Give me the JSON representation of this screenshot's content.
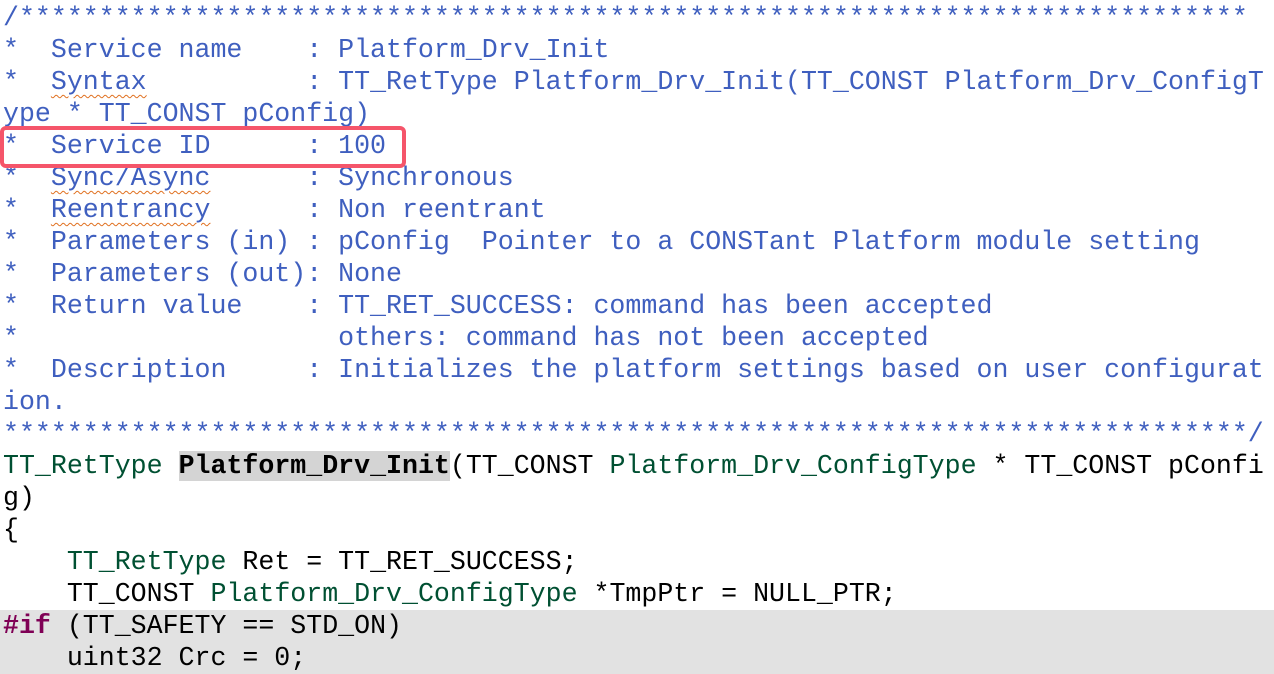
{
  "colors": {
    "comment": "#3f5fbf",
    "type": "#005032",
    "keyword": "#7f0055",
    "highlight": "#e2e2e2",
    "annotation": "#f5556a"
  },
  "lines": [
    {
      "hl": false,
      "segs": [
        {
          "s": "c",
          "x": "/*****************************************************************************"
        }
      ]
    },
    {
      "hl": false,
      "segs": [
        {
          "s": "c",
          "x": "*  Service name    : Platform_Drv_Init"
        }
      ]
    },
    {
      "hl": false,
      "segs": [
        {
          "s": "c",
          "x": "*  "
        },
        {
          "s": "c sq",
          "x": "Syntax"
        },
        {
          "s": "c",
          "x": "          : TT_RetType Platform_Drv_Init(TT_CONST Platform_Drv_ConfigType * TT_CONST pConfig)"
        }
      ]
    },
    {
      "hl": false,
      "segs": [
        {
          "s": "c",
          "x": "*  Service ID      : 100"
        }
      ]
    },
    {
      "hl": false,
      "segs": [
        {
          "s": "c",
          "x": "*  "
        },
        {
          "s": "c sq",
          "x": "Sync/Async"
        },
        {
          "s": "c",
          "x": "      : Synchronous"
        }
      ]
    },
    {
      "hl": false,
      "segs": [
        {
          "s": "c",
          "x": "*  "
        },
        {
          "s": "c sq",
          "x": "Reentrancy"
        },
        {
          "s": "c",
          "x": "      : Non reentrant"
        }
      ]
    },
    {
      "hl": false,
      "segs": [
        {
          "s": "c",
          "x": "*  Parameters (in) : pConfig  Pointer to a CONSTant Platform module setting"
        }
      ]
    },
    {
      "hl": false,
      "segs": [
        {
          "s": "c",
          "x": "*  Parameters (out): None"
        }
      ]
    },
    {
      "hl": false,
      "segs": [
        {
          "s": "c",
          "x": "*  Return value    : TT_RET_SUCCESS: command has been accepted"
        }
      ]
    },
    {
      "hl": false,
      "segs": [
        {
          "s": "c",
          "x": "*                    others: command has not been accepted"
        }
      ]
    },
    {
      "hl": false,
      "segs": [
        {
          "s": "c",
          "x": "*  Description     : Initializes the platform settings based on user configuration."
        }
      ]
    },
    {
      "hl": false,
      "segs": [
        {
          "s": "c",
          "x": "******************************************************************************/"
        }
      ]
    },
    {
      "hl": false,
      "segs": [
        {
          "s": "t",
          "x": "TT_RetType "
        },
        {
          "s": "fn",
          "x": "Platform_Drv_Init"
        },
        {
          "s": "p",
          "x": "(TT_CONST "
        },
        {
          "s": "t",
          "x": "Platform_Drv_ConfigType"
        },
        {
          "s": "p",
          "x": " * TT_CONST pConfig)"
        }
      ]
    },
    {
      "hl": false,
      "segs": [
        {
          "s": "p",
          "x": "{"
        }
      ]
    },
    {
      "hl": false,
      "segs": [
        {
          "s": "p",
          "x": "    "
        },
        {
          "s": "t",
          "x": "TT_RetType"
        },
        {
          "s": "p",
          "x": " Ret = TT_RET_SUCCESS;"
        }
      ]
    },
    {
      "hl": false,
      "segs": [
        {
          "s": "p",
          "x": "    TT_CONST "
        },
        {
          "s": "t",
          "x": "Platform_Drv_ConfigType"
        },
        {
          "s": "p",
          "x": " *TmpPtr = NULL_PTR;"
        }
      ]
    },
    {
      "hl": true,
      "segs": [
        {
          "s": "k",
          "x": "#if"
        },
        {
          "s": "p",
          "x": " (TT_SAFETY == STD_ON)"
        }
      ]
    },
    {
      "hl": true,
      "segs": [
        {
          "s": "p",
          "x": "    uint32 Crc = 0;"
        }
      ]
    }
  ]
}
